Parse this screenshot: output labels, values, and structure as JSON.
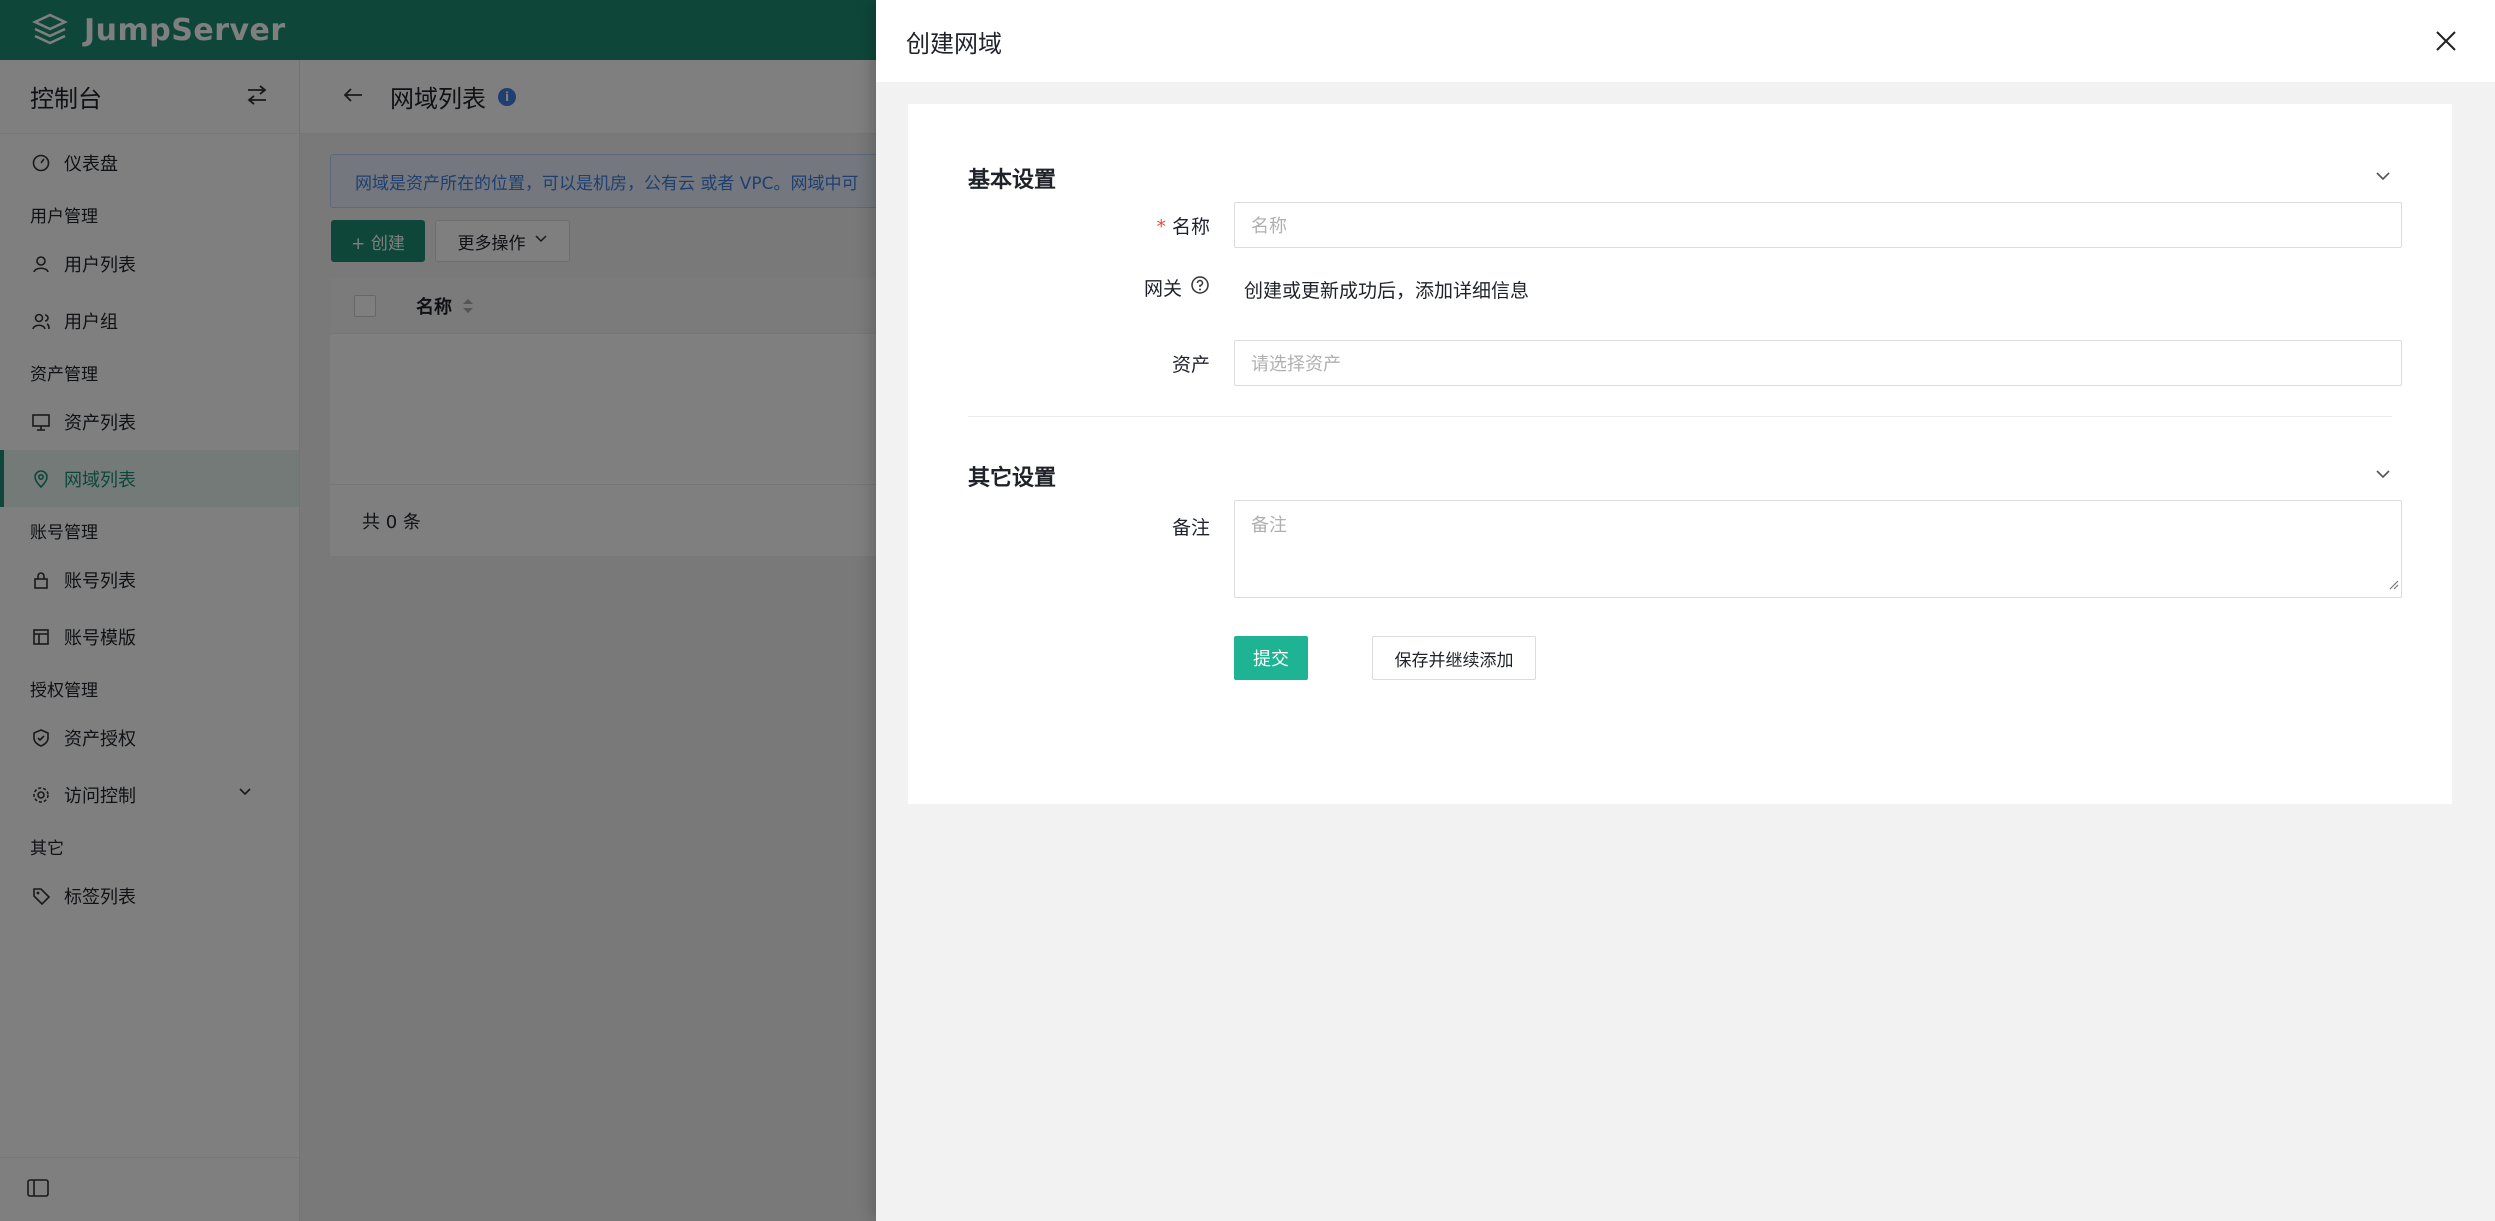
{
  "header": {
    "logo_text": "JumpServer",
    "brand_color": "#1c8f73"
  },
  "sidebar": {
    "title": "控制台",
    "items": [
      {
        "type": "item",
        "label": "仪表盘",
        "icon": "dashboard-icon"
      },
      {
        "type": "group",
        "label": "用户管理"
      },
      {
        "type": "item",
        "label": "用户列表",
        "icon": "user-icon"
      },
      {
        "type": "item",
        "label": "用户组",
        "icon": "users-icon"
      },
      {
        "type": "group",
        "label": "资产管理"
      },
      {
        "type": "item",
        "label": "资产列表",
        "icon": "monitor-icon"
      },
      {
        "type": "item",
        "label": "网域列表",
        "icon": "location-icon",
        "active": true
      },
      {
        "type": "group",
        "label": "账号管理"
      },
      {
        "type": "item",
        "label": "账号列表",
        "icon": "lock-icon"
      },
      {
        "type": "item",
        "label": "账号模版",
        "icon": "template-icon"
      },
      {
        "type": "group",
        "label": "授权管理"
      },
      {
        "type": "item",
        "label": "资产授权",
        "icon": "shield-icon"
      },
      {
        "type": "item",
        "label": "访问控制",
        "icon": "gear-icon",
        "expandable": true
      },
      {
        "type": "group",
        "label": "其它"
      },
      {
        "type": "item",
        "label": "标签列表",
        "icon": "tag-icon"
      }
    ]
  },
  "main": {
    "title": "网域列表",
    "notice": "网域是资产所在的位置，可以是机房，公有云 或者 VPC。网域中可",
    "create_label": "+ 创建",
    "more_label": "更多操作",
    "table": {
      "column_name": "名称",
      "footer": "共 0 条"
    }
  },
  "drawer": {
    "title": "创建网域",
    "sections": {
      "basic": "基本设置",
      "other": "其它设置"
    },
    "fields": {
      "name_label": "名称",
      "name_placeholder": "名称",
      "gateway_label": "网关",
      "gateway_text": "创建或更新成功后，添加详细信息",
      "asset_label": "资产",
      "asset_placeholder": "请选择资产",
      "comment_label": "备注",
      "comment_placeholder": "备注"
    },
    "buttons": {
      "submit": "提交",
      "save_continue": "保存并继续添加"
    },
    "submit_color": "#1db393"
  }
}
